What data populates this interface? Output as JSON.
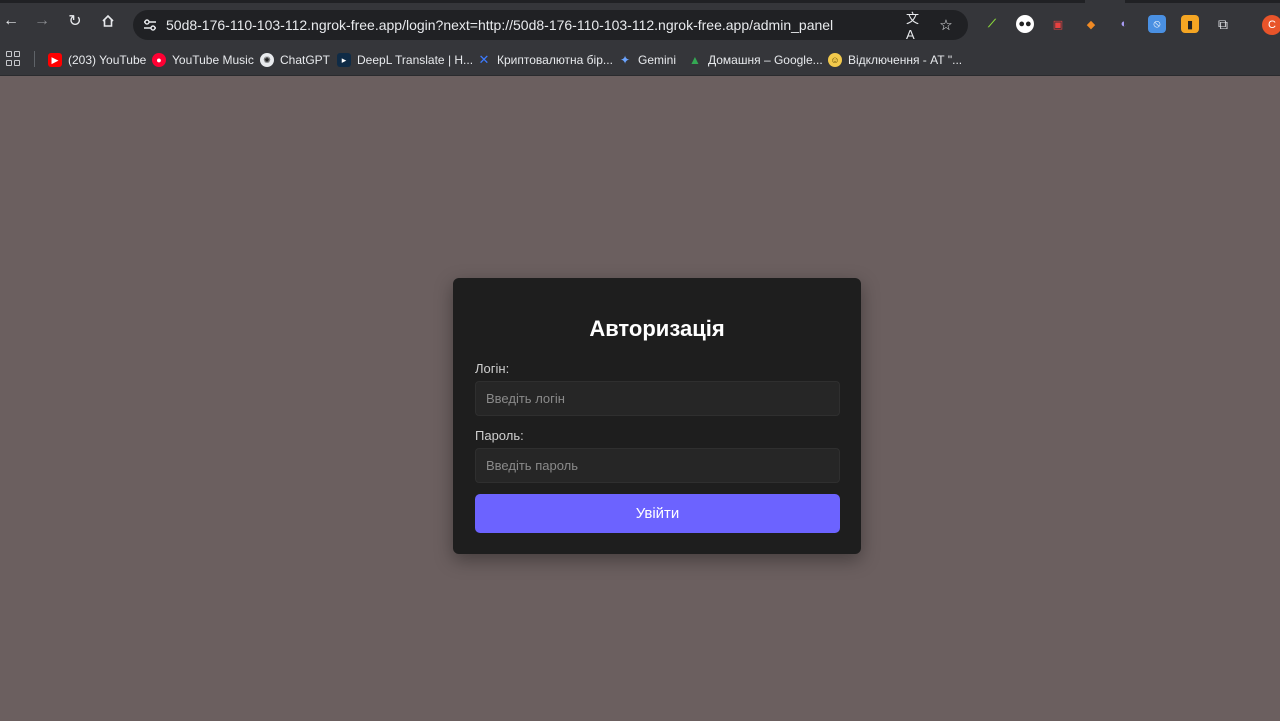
{
  "browser": {
    "url": "50d8-176-110-103-112.ngrok-free.app/login?next=http://50d8-176-110-103-112.ngrok-free.app/admin_panel",
    "profile_initial": "C",
    "extensions": [
      {
        "name": "chart-extension-icon",
        "color": "#3f3f3f",
        "glyph": "📈"
      },
      {
        "name": "panda-extension-icon",
        "color": "#3f3f3f",
        "glyph": "🐼"
      },
      {
        "name": "lock-extension-icon",
        "color": "#3f3f3f",
        "glyph": "🔒"
      },
      {
        "name": "metamask-extension-icon",
        "color": "#3f3f3f",
        "glyph": "🦊"
      },
      {
        "name": "ghost-extension-icon",
        "color": "#3f3f3f",
        "glyph": "👻"
      },
      {
        "name": "blue-extension-icon",
        "color": "#4a90e2",
        "glyph": "◈"
      },
      {
        "name": "orange-extension-icon",
        "color": "#f5a623",
        "glyph": "▣"
      }
    ]
  },
  "bookmarks": [
    {
      "label": "(203) YouTube",
      "icon": "youtube-icon",
      "color": "#ff0000",
      "glyph": "▶"
    },
    {
      "label": "YouTube Music",
      "icon": "youtube-music-icon",
      "color": "#ff0033",
      "glyph": "●"
    },
    {
      "label": "ChatGPT",
      "icon": "chatgpt-icon",
      "color": "#4a4a4a",
      "glyph": "✺"
    },
    {
      "label": "DeepL Translate | Н...",
      "icon": "deepl-icon",
      "color": "#0f2b46",
      "glyph": "▸"
    },
    {
      "label": "Криптовалютна бір...",
      "icon": "crypto-exchange-icon",
      "color": "#2a5bd7",
      "glyph": "✕"
    },
    {
      "label": "Gemini",
      "icon": "gemini-icon",
      "color": "#35363a",
      "glyph": "✦"
    },
    {
      "label": "Домашня – Google...",
      "icon": "google-drive-icon",
      "color": "#35363a",
      "glyph": "▲"
    },
    {
      "label": "Відключення - АТ \"...",
      "icon": "emoji-icon",
      "color": "#35363a",
      "glyph": "😊"
    }
  ],
  "login": {
    "title": "Авторизація",
    "login_label": "Логін:",
    "login_placeholder": "Введіть логін",
    "password_label": "Пароль:",
    "password_placeholder": "Введіть пароль",
    "submit_label": "Увійти"
  },
  "colors": {
    "page_background": "#6b5f5f",
    "card_background": "#1e1e1e",
    "accent": "#6c63ff"
  }
}
